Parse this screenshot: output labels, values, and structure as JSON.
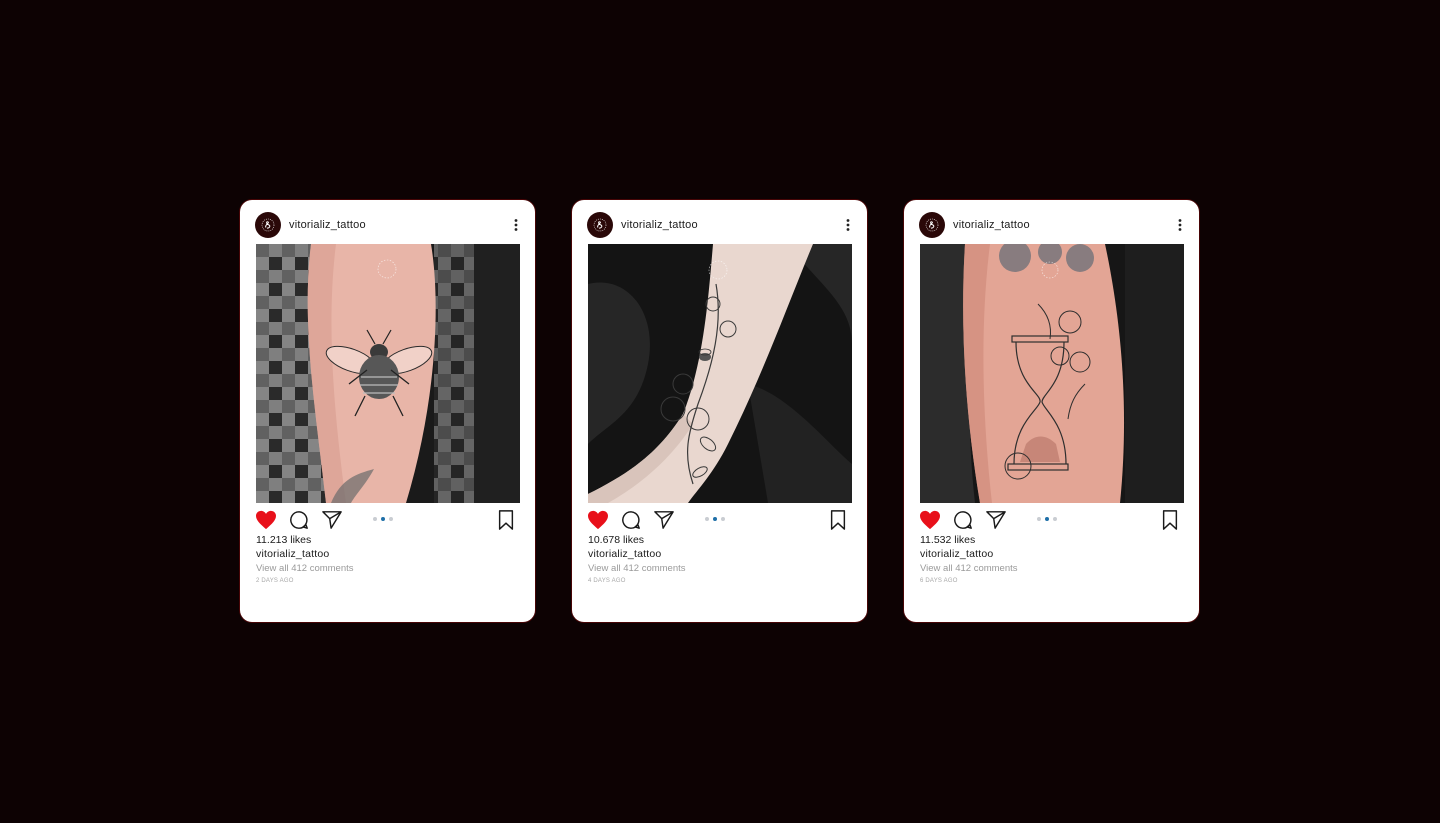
{
  "posts": [
    {
      "username": "vitorializ_tattoo",
      "likes": "11.213 likes",
      "caption_user": "vitorializ_tattoo",
      "comments_link": "View all 412 comments",
      "time_ago": "2 DAYS AGO",
      "photo_subject": "bee tattoo on forearm",
      "carousel_active_index": 1,
      "carousel_count": 3
    },
    {
      "username": "vitorializ_tattoo",
      "likes": "10.678 likes",
      "caption_user": "vitorializ_tattoo",
      "comments_link": "View all 412 comments",
      "time_ago": "4 DAYS AGO",
      "photo_subject": "floral vine and bee tattoo on wrist",
      "carousel_active_index": 1,
      "carousel_count": 3
    },
    {
      "username": "vitorializ_tattoo",
      "likes": "11.532 likes",
      "caption_user": "vitorializ_tattoo",
      "comments_link": "View all 412 comments",
      "time_ago": "6 DAYS AGO",
      "photo_subject": "hourglass with flowers tattoo on arm",
      "carousel_active_index": 1,
      "carousel_count": 3
    }
  ],
  "colors": {
    "background": "#0d0203",
    "card": "#ffffff",
    "like_red": "#e8101a",
    "carousel_active": "#1f6fa8",
    "carousel_inactive": "#c9cdd2"
  },
  "icons": [
    "heart-icon",
    "comment-icon",
    "share-icon",
    "bookmark-icon",
    "more-options-icon",
    "avatar-logo-icon"
  ]
}
